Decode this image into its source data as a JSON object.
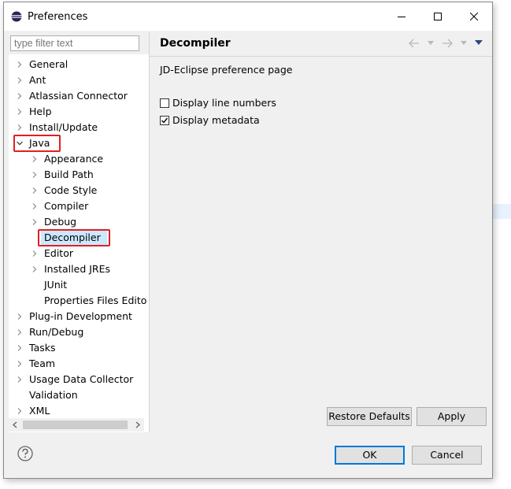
{
  "window": {
    "title": "Preferences"
  },
  "filter": {
    "placeholder": "type filter text"
  },
  "tree": {
    "items": [
      {
        "label": "General",
        "level": 0,
        "expander": "collapsed"
      },
      {
        "label": "Ant",
        "level": 0,
        "expander": "collapsed"
      },
      {
        "label": "Atlassian Connector",
        "level": 0,
        "expander": "collapsed"
      },
      {
        "label": "Help",
        "level": 0,
        "expander": "collapsed"
      },
      {
        "label": "Install/Update",
        "level": 0,
        "expander": "collapsed"
      },
      {
        "label": "Java",
        "level": 0,
        "expander": "expanded",
        "highlighted": true
      },
      {
        "label": "Appearance",
        "level": 1,
        "expander": "collapsed"
      },
      {
        "label": "Build Path",
        "level": 1,
        "expander": "collapsed"
      },
      {
        "label": "Code Style",
        "level": 1,
        "expander": "collapsed"
      },
      {
        "label": "Compiler",
        "level": 1,
        "expander": "collapsed"
      },
      {
        "label": "Debug",
        "level": 1,
        "expander": "collapsed"
      },
      {
        "label": "Decompiler",
        "level": 1,
        "expander": "none",
        "selected": true,
        "highlighted": true
      },
      {
        "label": "Editor",
        "level": 1,
        "expander": "collapsed"
      },
      {
        "label": "Installed JREs",
        "level": 1,
        "expander": "collapsed"
      },
      {
        "label": "JUnit",
        "level": 1,
        "expander": "none"
      },
      {
        "label": "Properties Files Edito",
        "level": 1,
        "expander": "none"
      },
      {
        "label": "Plug-in Development",
        "level": 0,
        "expander": "collapsed"
      },
      {
        "label": "Run/Debug",
        "level": 0,
        "expander": "collapsed"
      },
      {
        "label": "Tasks",
        "level": 0,
        "expander": "collapsed"
      },
      {
        "label": "Team",
        "level": 0,
        "expander": "collapsed"
      },
      {
        "label": "Usage Data Collector",
        "level": 0,
        "expander": "collapsed"
      },
      {
        "label": "Validation",
        "level": 0,
        "expander": "none"
      },
      {
        "label": "XML",
        "level": 0,
        "expander": "collapsed"
      }
    ]
  },
  "page": {
    "title": "Decompiler",
    "description": "JD-Eclipse preference page",
    "options": [
      {
        "label": "Display line numbers",
        "checked": false
      },
      {
        "label": "Display metadata",
        "checked": true
      }
    ]
  },
  "buttons": {
    "restore_defaults": "Restore Defaults",
    "apply": "Apply",
    "ok": "OK",
    "cancel": "Cancel"
  },
  "colors": {
    "highlight_box": "#e02020",
    "selection": "#cce8ff",
    "default_button_border": "#0078d7"
  },
  "icons": [
    "eclipse-icon",
    "minimize-icon",
    "maximize-icon",
    "close-icon",
    "back-arrow-icon",
    "forward-arrow-icon",
    "view-menu-icon",
    "help-icon"
  ]
}
